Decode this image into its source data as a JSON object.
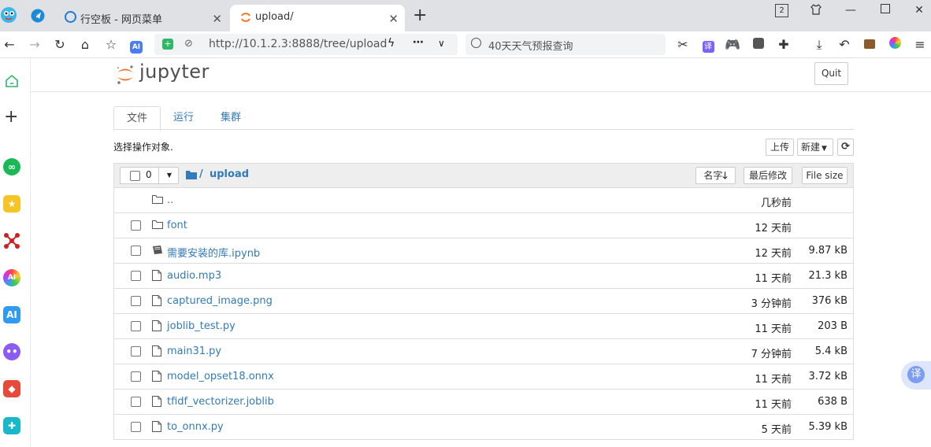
{
  "browser": {
    "tabs": [
      {
        "label": "行空板 - 网页菜单",
        "active": false
      },
      {
        "label": "upload/",
        "active": true
      }
    ],
    "new_tab": "+",
    "window_badge": "2",
    "address": {
      "url": "http://10.1.2.3:8888/tree/upload"
    },
    "search": {
      "placeholder": "40天天气预报查询"
    },
    "floating_translate": "译"
  },
  "sidebar": {
    "items": [
      "home-icon",
      "add-icon",
      "mini-program-icon",
      "favorites-icon",
      "graph-icon",
      "ai-assistant-icon",
      "ai-icon",
      "chat-icon",
      "game-icon",
      "tools-icon"
    ],
    "ai_text": "AI"
  },
  "jupyter": {
    "logo_text": "jupyter",
    "quit": "Quit",
    "tabs": [
      "文件",
      "运行",
      "集群"
    ],
    "select_prompt": "选择操作对象.",
    "upload_btn": "上传",
    "new_btn": "新建",
    "selected_count": "0",
    "breadcrumb_root": "/",
    "breadcrumb_folder": "upload",
    "sort_name": "名字",
    "sort_modified": "最后修改",
    "sort_size": "File size",
    "files": [
      {
        "name": "..",
        "type": "folder",
        "modified": "几秒前",
        "size": ""
      },
      {
        "name": "font",
        "type": "folder",
        "modified": "12 天前",
        "size": ""
      },
      {
        "name": "需要安装的库.ipynb",
        "type": "notebook",
        "modified": "12 天前",
        "size": "9.87 kB"
      },
      {
        "name": "audio.mp3",
        "type": "file",
        "modified": "11 天前",
        "size": "21.3 kB"
      },
      {
        "name": "captured_image.png",
        "type": "file",
        "modified": "3 分钟前",
        "size": "376 kB"
      },
      {
        "name": "joblib_test.py",
        "type": "file",
        "modified": "11 天前",
        "size": "203 B"
      },
      {
        "name": "main31.py",
        "type": "file",
        "modified": "7 分钟前",
        "size": "5.4 kB"
      },
      {
        "name": "model_opset18.onnx",
        "type": "file",
        "modified": "11 天前",
        "size": "3.72 kB"
      },
      {
        "name": "tfidf_vectorizer.joblib",
        "type": "file",
        "modified": "11 天前",
        "size": "638 B"
      },
      {
        "name": "to_onnx.py",
        "type": "file",
        "modified": "5 天前",
        "size": "5.39 kB"
      }
    ]
  },
  "colors": {
    "link": "#337ab7",
    "accent_orange": "#f37726",
    "tabstrip": "#dfe1e5"
  }
}
